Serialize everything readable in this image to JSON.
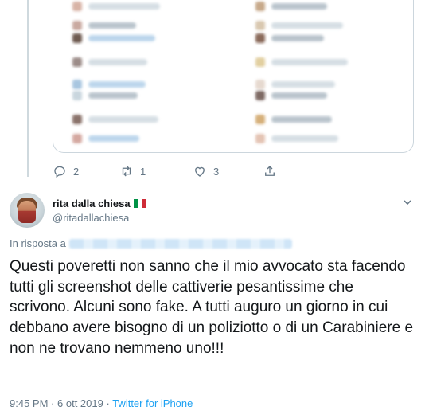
{
  "colors": {
    "accent": "#1da1f2",
    "muted": "#657786",
    "border": "#ccd6dd",
    "text": "#14171a"
  },
  "actions": {
    "reply": {
      "icon": "reply-icon",
      "count": "2"
    },
    "retweet": {
      "icon": "retweet-icon",
      "count": "1"
    },
    "like": {
      "icon": "heart-icon",
      "count": "3"
    },
    "share": {
      "icon": "share-icon"
    }
  },
  "tweet": {
    "display_name": "rita dalla chiesa",
    "flag_icon": "italy-flag-icon",
    "handle": "@ritadallachiesa",
    "reply_prefix": "In risposta a",
    "text": "Questi poveretti non sanno che il mio avvocato sta facendo tutti gli screenshot delle cattiverie pesantissime che scrivono. Alcuni sono fake.  A tutti auguro un giorno in cui debbano avere bisogno di un poliziotto o di un Carabiniere e non ne trovano nemmeno uno!!!",
    "time": "9:45 PM",
    "date": "6 ott 2019",
    "separator": "·",
    "source": "Twitter for iPhone"
  }
}
